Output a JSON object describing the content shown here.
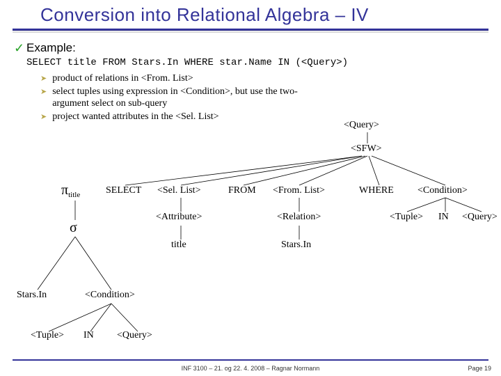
{
  "title": "Conversion into Relational Algebra – IV",
  "example_label": "Example:",
  "sql": "SELECT title FROM Stars.In WHERE star.Name IN (<Query>)",
  "bullets": [
    "product of relations in <From. List>",
    "select tuples using expression in <Condition>, but use the two-argument select on sub-query",
    "project wanted attributes in the <Sel. List>"
  ],
  "nodes": {
    "query_top": "<Query>",
    "sfw": "<SFW>",
    "kw_select": "SELECT",
    "sellist": "<Sel. List>",
    "kw_from": "FROM",
    "fromlist": "<From. List>",
    "kw_where": "WHERE",
    "condition_r": "<Condition>",
    "attribute": "<Attribute>",
    "relation": "<Relation>",
    "tuple_r": "<Tuple>",
    "in_r": "IN",
    "query_r": "<Query>",
    "title_leaf": "title",
    "starsin_leaf": "Stars.In",
    "pi": "π",
    "pi_sub": "title",
    "sigma": "σ",
    "starsin_l": "Stars.In",
    "condition_l": "<Condition>",
    "tuple_l": "<Tuple>",
    "in_l": "IN",
    "query_l": "<Query>"
  },
  "footer_center": "INF 3100 – 21. og 22. 4. 2008 – Ragnar Normann",
  "footer_page": "Page 19"
}
